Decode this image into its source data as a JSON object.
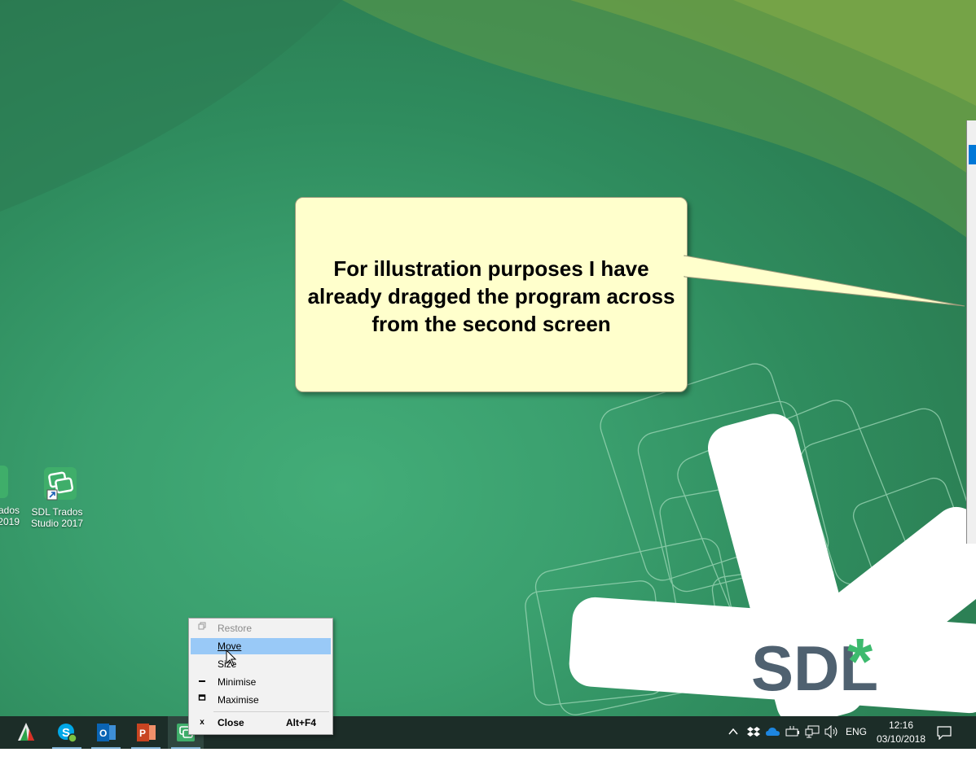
{
  "callout": {
    "text": "For illustration purposes I have already dragged the program across from the second screen"
  },
  "desktop_icons": [
    {
      "label_line1": "ados",
      "label_line2": "2019"
    },
    {
      "label_line1": "SDL Trados",
      "label_line2": "Studio 2017"
    }
  ],
  "wallpaper": {
    "logo_text": "SDL",
    "logo_star": "*"
  },
  "context_menu": {
    "items": [
      {
        "label": "Restore",
        "accelerator": "",
        "glyph": "▫",
        "disabled": true
      },
      {
        "label": "Move",
        "accelerator": "",
        "glyph": "",
        "highlighted": true
      },
      {
        "label": "Size",
        "accelerator": "",
        "glyph": ""
      },
      {
        "label": "Minimise",
        "accelerator": "",
        "glyph": "–"
      },
      {
        "label": "Maximise",
        "accelerator": "",
        "glyph": "□"
      },
      {
        "label": "Close",
        "accelerator": "Alt+F4",
        "glyph": "x",
        "bold": true
      }
    ]
  },
  "taskbar": {
    "tray_language": "ENG",
    "clock_time": "12:16",
    "clock_date": "03/10/2018",
    "tray_chevron": "^"
  },
  "colors": {
    "taskbar_bg": "#1c2d28",
    "menu_highlight": "#99c9f7",
    "callout_bg": "#ffffcc",
    "sdl_green": "#3dba6e",
    "sdl_slate": "#4f6170"
  }
}
